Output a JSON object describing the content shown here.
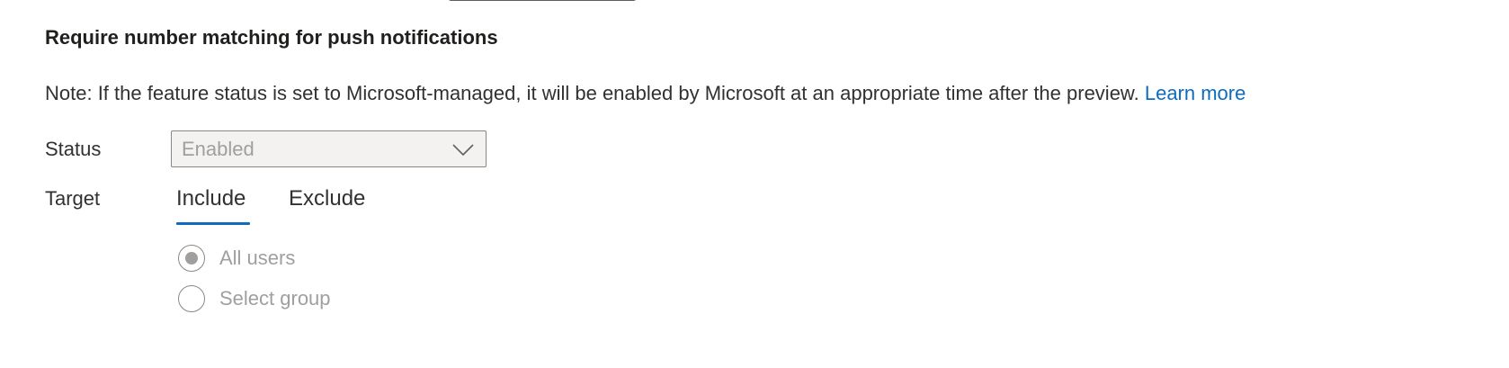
{
  "section": {
    "title": "Require number matching for push notifications",
    "note_text": "Note: If the feature status is set to Microsoft-managed, it will be enabled by Microsoft at an appropriate time after the preview.",
    "learn_more_label": "Learn more"
  },
  "status": {
    "label": "Status",
    "selected_value": "Enabled",
    "disabled": true,
    "chevron_icon": "chevron-down-icon"
  },
  "target": {
    "label": "Target",
    "tabs": [
      {
        "label": "Include",
        "selected": true
      },
      {
        "label": "Exclude",
        "selected": false
      }
    ],
    "options": [
      {
        "label": "All users",
        "checked": true
      },
      {
        "label": "Select group",
        "checked": false
      }
    ]
  },
  "colors": {
    "link": "#0f6cbd",
    "tab_underline": "#0f6cbd",
    "disabled_text": "#a19f9d",
    "dropdown_bg": "#f3f2f1",
    "text": "#323130"
  }
}
